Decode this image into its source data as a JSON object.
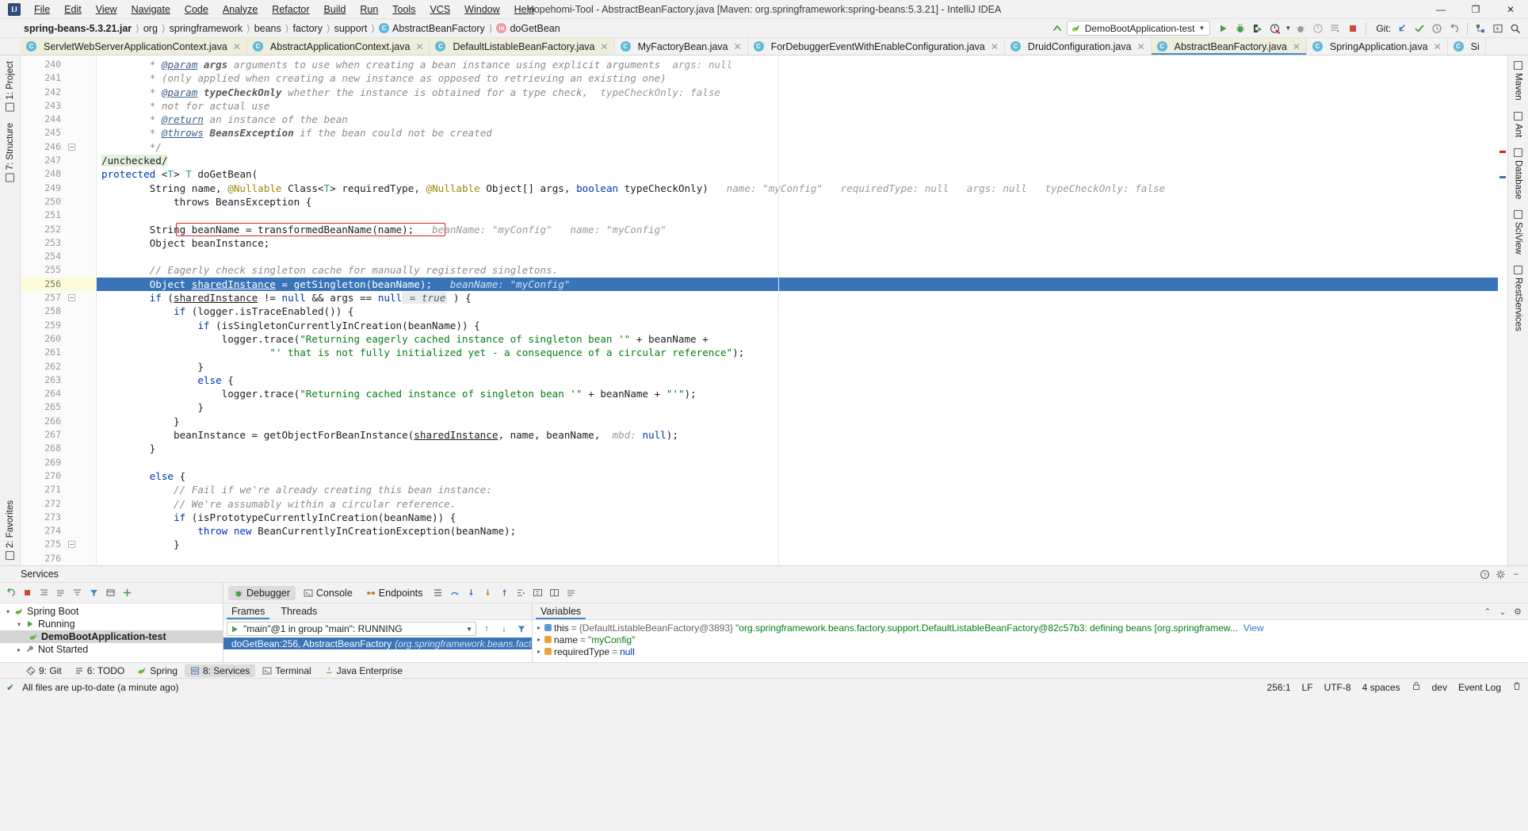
{
  "window": {
    "title": "Hopehomi-Tool - AbstractBeanFactory.java [Maven: org.springframework:spring-beans:5.3.21] - IntelliJ IDEA",
    "logo_text": "IJ",
    "minimize": "—",
    "maximize": "❐",
    "close": "✕"
  },
  "menu": [
    {
      "label": "File"
    },
    {
      "label": "Edit"
    },
    {
      "label": "View"
    },
    {
      "label": "Navigate"
    },
    {
      "label": "Code"
    },
    {
      "label": "Analyze"
    },
    {
      "label": "Refactor"
    },
    {
      "label": "Build"
    },
    {
      "label": "Run"
    },
    {
      "label": "Tools"
    },
    {
      "label": "VCS"
    },
    {
      "label": "Window"
    },
    {
      "label": "Help"
    }
  ],
  "breadcrumbs": [
    {
      "label": "spring-beans-5.3.21.jar",
      "icon": "",
      "bold": true
    },
    {
      "label": "org",
      "icon": ""
    },
    {
      "label": "springframework",
      "icon": ""
    },
    {
      "label": "beans",
      "icon": ""
    },
    {
      "label": "factory",
      "icon": ""
    },
    {
      "label": "support",
      "icon": ""
    },
    {
      "label": "AbstractBeanFactory",
      "icon": "class-icon",
      "badge": "C"
    },
    {
      "label": "doGetBean",
      "icon": "method-icon",
      "badge": "m"
    }
  ],
  "toolbar": {
    "run_config": "DemoBootApplication-test",
    "git_label": "Git:",
    "icons": [
      {
        "name": "build-icon",
        "glyph": "⬆"
      },
      {
        "name": "run-icon",
        "glyph": "▶"
      },
      {
        "name": "debug-icon",
        "glyph": "🐞"
      },
      {
        "name": "run-with-coverage-icon",
        "glyph": "▷"
      },
      {
        "name": "profile-icon",
        "glyph": "◔"
      },
      {
        "name": "attach-icon",
        "glyph": "◉"
      },
      {
        "name": "stop-icon",
        "glyph": "■"
      }
    ]
  },
  "editor_tabs": [
    {
      "label": "ServletWebServerApplicationContext.java",
      "active": false
    },
    {
      "label": "AbstractApplicationContext.java",
      "active": false
    },
    {
      "label": "DefaultListableBeanFactory.java",
      "active": false
    },
    {
      "label": "MyFactoryBean.java",
      "active": false
    },
    {
      "label": "ForDebuggerEventWithEnableConfiguration.java",
      "active": false
    },
    {
      "label": "DruidConfiguration.java",
      "active": false
    },
    {
      "label": "AbstractBeanFactory.java",
      "active": true
    },
    {
      "label": "SpringApplication.java",
      "active": false
    },
    {
      "label": "Si",
      "active": false
    }
  ],
  "left_tool_tabs": [
    {
      "label": "1: Project"
    },
    {
      "label": "7: Structure"
    },
    {
      "label": "2: Favorites"
    }
  ],
  "right_tool_tabs": [
    {
      "label": "Maven"
    },
    {
      "label": "Ant"
    },
    {
      "label": "Database"
    },
    {
      "label": "SciView"
    },
    {
      "label": "RestServices"
    }
  ],
  "editor": {
    "first_line": 239,
    "current_line": 256,
    "lines": [
      {
        "n": 240,
        "tokens": [
          {
            "t": "        * ",
            "c": "cm"
          },
          {
            "t": "@param",
            "c": "doctag"
          },
          {
            "t": " ",
            "c": "cm"
          },
          {
            "t": "args",
            "c": "cmb"
          },
          {
            "t": " arguments to use when creating a bean instance using explicit arguments",
            "c": "cm"
          },
          {
            "t": "  args: null",
            "c": "hint"
          }
        ]
      },
      {
        "n": 241,
        "tokens": [
          {
            "t": "        * (only applied when creating a new instance as opposed to retrieving an existing one)",
            "c": "cm"
          }
        ]
      },
      {
        "n": 242,
        "tokens": [
          {
            "t": "        * ",
            "c": "cm"
          },
          {
            "t": "@param",
            "c": "doctag"
          },
          {
            "t": " ",
            "c": "cm"
          },
          {
            "t": "typeCheckOnly",
            "c": "cmb"
          },
          {
            "t": " whether the instance is obtained for a type check,",
            "c": "cm"
          },
          {
            "t": "  typeCheckOnly: false",
            "c": "hint"
          }
        ]
      },
      {
        "n": 243,
        "tokens": [
          {
            "t": "        * not for actual use",
            "c": "cm"
          }
        ]
      },
      {
        "n": 244,
        "tokens": [
          {
            "t": "        * ",
            "c": "cm"
          },
          {
            "t": "@return",
            "c": "doctag"
          },
          {
            "t": " an instance of the bean",
            "c": "cm"
          }
        ]
      },
      {
        "n": 245,
        "tokens": [
          {
            "t": "        * ",
            "c": "cm"
          },
          {
            "t": "@throws",
            "c": "doctag"
          },
          {
            "t": " ",
            "c": "cm"
          },
          {
            "t": "BeansException",
            "c": "cmb"
          },
          {
            "t": " if the bean could not be created",
            "c": "cm"
          }
        ]
      },
      {
        "n": 246,
        "tokens": [
          {
            "t": "        */",
            "c": "cm"
          }
        ],
        "fold": true
      },
      {
        "n": 247,
        "tokens": [
          {
            "t": "/unchecked/",
            "c": "unchecked"
          }
        ]
      },
      {
        "n": 248,
        "tokens": [
          {
            "t": "protected",
            "c": "kw"
          },
          {
            "t": " <",
            "c": "pl"
          },
          {
            "t": "T",
            "c": "ty"
          },
          {
            "t": "> ",
            "c": "pl"
          },
          {
            "t": "T",
            "c": "ty"
          },
          {
            "t": " doGetBean(",
            "c": "pl"
          }
        ]
      },
      {
        "n": 249,
        "tokens": [
          {
            "t": "        String name, ",
            "c": "pl"
          },
          {
            "t": "@Nullable",
            "c": "anno"
          },
          {
            "t": " Class<",
            "c": "pl"
          },
          {
            "t": "T",
            "c": "ty"
          },
          {
            "t": "> requiredType, ",
            "c": "pl"
          },
          {
            "t": "@Nullable",
            "c": "anno"
          },
          {
            "t": " Object[] args, ",
            "c": "pl"
          },
          {
            "t": "boolean",
            "c": "kw"
          },
          {
            "t": " typeCheckOnly)",
            "c": "pl"
          },
          {
            "t": "   name: \"myConfig\"   requiredType: null   args: null   typeCheckOnly: false",
            "c": "hint"
          }
        ]
      },
      {
        "n": 250,
        "tokens": [
          {
            "t": "            throws BeansException {",
            "c": "pl"
          }
        ]
      },
      {
        "n": 251,
        "tokens": [
          {
            "t": "",
            "c": "pl"
          }
        ]
      },
      {
        "n": 252,
        "tokens": [
          {
            "t": "        String beanName = transformedBeanName(name);",
            "c": "pl"
          },
          {
            "t": "   beanName: \"myConfig\"   name: \"myConfig\"",
            "c": "hint"
          }
        ],
        "redbox": true
      },
      {
        "n": 253,
        "tokens": [
          {
            "t": "        Object beanInstance;",
            "c": "pl"
          }
        ]
      },
      {
        "n": 254,
        "tokens": [
          {
            "t": "",
            "c": "pl"
          }
        ]
      },
      {
        "n": 255,
        "tokens": [
          {
            "t": "        // Eagerly check singleton cache for manually registered singletons.",
            "c": "cm"
          }
        ]
      },
      {
        "n": 256,
        "tokens": [
          {
            "t": "        Object ",
            "c": "pl"
          },
          {
            "t": "sharedInstance",
            "c": "fld"
          },
          {
            "t": " = getSingleton(beanName);",
            "c": "pl"
          },
          {
            "t": "   beanName: \"myConfig\"",
            "c": "hint"
          }
        ],
        "highlight": true
      },
      {
        "n": 257,
        "tokens": [
          {
            "t": "        ",
            "c": "pl"
          },
          {
            "t": "if",
            "c": "kw"
          },
          {
            "t": " (",
            "c": "pl"
          },
          {
            "t": "sharedInstance",
            "c": "fld"
          },
          {
            "t": " != ",
            "c": "pl"
          },
          {
            "t": "null",
            "c": "kw"
          },
          {
            "t": " && args == ",
            "c": "pl"
          },
          {
            "t": "null",
            "c": "kw"
          },
          {
            "t": " = true",
            "c": "hintbg"
          },
          {
            "t": " ) {",
            "c": "pl"
          }
        ],
        "fold": true
      },
      {
        "n": 258,
        "tokens": [
          {
            "t": "            ",
            "c": "pl"
          },
          {
            "t": "if",
            "c": "kw"
          },
          {
            "t": " (logger.isTraceEnabled()) {",
            "c": "pl"
          }
        ]
      },
      {
        "n": 259,
        "tokens": [
          {
            "t": "                ",
            "c": "pl"
          },
          {
            "t": "if",
            "c": "kw"
          },
          {
            "t": " (isSingletonCurrentlyInCreation(beanName)) {",
            "c": "pl"
          }
        ]
      },
      {
        "n": 260,
        "tokens": [
          {
            "t": "                    logger.trace(",
            "c": "pl"
          },
          {
            "t": "\"Returning eagerly cached instance of singleton bean '\"",
            "c": "str"
          },
          {
            "t": " + beanName +",
            "c": "pl"
          }
        ]
      },
      {
        "n": 261,
        "tokens": [
          {
            "t": "                            ",
            "c": "pl"
          },
          {
            "t": "\"' that is not fully initialized yet - a consequence of a circular reference\"",
            "c": "str"
          },
          {
            "t": ");",
            "c": "pl"
          }
        ]
      },
      {
        "n": 262,
        "tokens": [
          {
            "t": "                }",
            "c": "pl"
          }
        ]
      },
      {
        "n": 263,
        "tokens": [
          {
            "t": "                ",
            "c": "pl"
          },
          {
            "t": "else",
            "c": "kw"
          },
          {
            "t": " {",
            "c": "pl"
          }
        ]
      },
      {
        "n": 264,
        "tokens": [
          {
            "t": "                    logger.trace(",
            "c": "pl"
          },
          {
            "t": "\"Returning cached instance of singleton bean '\"",
            "c": "str"
          },
          {
            "t": " + beanName + ",
            "c": "pl"
          },
          {
            "t": "\"'\"",
            "c": "str"
          },
          {
            "t": ");",
            "c": "pl"
          }
        ]
      },
      {
        "n": 265,
        "tokens": [
          {
            "t": "                }",
            "c": "pl"
          }
        ]
      },
      {
        "n": 266,
        "tokens": [
          {
            "t": "            }",
            "c": "pl"
          }
        ]
      },
      {
        "n": 267,
        "tokens": [
          {
            "t": "            beanInstance = getObjectForBeanInstance(",
            "c": "pl"
          },
          {
            "t": "sharedInstance",
            "c": "fld"
          },
          {
            "t": ", name, beanName, ",
            "c": "pl"
          },
          {
            "t": " mbd:",
            "c": "hint"
          },
          {
            "t": " ",
            "c": "pl"
          },
          {
            "t": "null",
            "c": "kw"
          },
          {
            "t": ");",
            "c": "pl"
          }
        ]
      },
      {
        "n": 268,
        "tokens": [
          {
            "t": "        }",
            "c": "pl"
          }
        ]
      },
      {
        "n": 269,
        "tokens": [
          {
            "t": "",
            "c": "pl"
          }
        ]
      },
      {
        "n": 270,
        "tokens": [
          {
            "t": "        ",
            "c": "pl"
          },
          {
            "t": "else",
            "c": "kw"
          },
          {
            "t": " {",
            "c": "pl"
          }
        ]
      },
      {
        "n": 271,
        "tokens": [
          {
            "t": "            // Fail if we're already creating this bean instance:",
            "c": "cm"
          }
        ]
      },
      {
        "n": 272,
        "tokens": [
          {
            "t": "            // We're assumably within a circular reference.",
            "c": "cm"
          }
        ]
      },
      {
        "n": 273,
        "tokens": [
          {
            "t": "            ",
            "c": "pl"
          },
          {
            "t": "if",
            "c": "kw"
          },
          {
            "t": " (isPrototypeCurrentlyInCreation(beanName)) {",
            "c": "pl"
          }
        ]
      },
      {
        "n": 274,
        "tokens": [
          {
            "t": "                ",
            "c": "pl"
          },
          {
            "t": "throw",
            "c": "kw"
          },
          {
            "t": " ",
            "c": "pl"
          },
          {
            "t": "new",
            "c": "kw"
          },
          {
            "t": " BeanCurrentlyInCreationException(beanName);",
            "c": "pl"
          }
        ]
      },
      {
        "n": 275,
        "tokens": [
          {
            "t": "            }",
            "c": "pl"
          }
        ],
        "fold": true
      },
      {
        "n": 276,
        "tokens": [
          {
            "t": "",
            "c": "pl"
          }
        ]
      }
    ]
  },
  "services": {
    "header_title": "Services",
    "tree": [
      {
        "label": "Spring Boot",
        "depth": 0,
        "expanded": true,
        "icon": "leaf-icon",
        "selected": false
      },
      {
        "label": "Running",
        "depth": 1,
        "expanded": true,
        "icon": "run-icon",
        "selected": false
      },
      {
        "label": "DemoBootApplication-test",
        "depth": 2,
        "expanded": false,
        "icon": "leaf-icon",
        "selected": true,
        "bold": true
      },
      {
        "label": "Not Started",
        "depth": 1,
        "expanded": false,
        "icon": "wrench-icon",
        "selected": false
      }
    ],
    "debug_tabs": [
      {
        "label": "Debugger",
        "active": true,
        "icon": "debugger-icon"
      },
      {
        "label": "Console",
        "active": false,
        "icon": "console-icon"
      },
      {
        "label": "Endpoints",
        "active": false,
        "icon": "endpoints-icon"
      }
    ],
    "frames_panel": {
      "tabs": [
        {
          "label": "Frames",
          "active": true
        },
        {
          "label": "Threads",
          "active": false
        }
      ],
      "thread_selector": "\"main\"@1 in group \"main\": RUNNING",
      "frames": [
        {
          "method": "doGetBean:256, AbstractBeanFactory",
          "location": "(org.springframework.beans.factory.supp",
          "selected": true
        }
      ]
    },
    "variables_panel": {
      "title": "Variables",
      "rows": [
        {
          "indent": 0,
          "expandable": true,
          "name": "this",
          "eq": "=",
          "value": "{DefaultListableBeanFactory@3893}",
          "detail": "\"org.springframework.beans.factory.support.DefaultListableBeanFactory@82c57b3: defining beans [org.springframew...",
          "link": "View",
          "icon": "field-blue"
        },
        {
          "indent": 0,
          "expandable": true,
          "name": "name",
          "eq": "=",
          "value": "\"myConfig\"",
          "detail": "",
          "icon": "field-orange"
        },
        {
          "indent": 0,
          "expandable": true,
          "name": "requiredType",
          "eq": "=",
          "value": "null",
          "detail": "",
          "icon": "field-orange"
        }
      ]
    }
  },
  "bottom_tabs": [
    {
      "label": "9: Git",
      "icon": "git-icon",
      "active": false
    },
    {
      "label": "6: TODO",
      "icon": "todo-icon",
      "active": false
    },
    {
      "label": "Spring",
      "icon": "spring-icon",
      "active": false
    },
    {
      "label": "8: Services",
      "icon": "services-icon",
      "active": true
    },
    {
      "label": "Terminal",
      "icon": "terminal-icon",
      "active": false
    },
    {
      "label": "Java Enterprise",
      "icon": "java-icon",
      "active": false
    }
  ],
  "status_bar": {
    "message": "All files are up-to-date (a minute ago)",
    "caret": "256:1",
    "line_sep": "LF",
    "encoding": "UTF-8",
    "indent": "4 spaces",
    "event_log": "Event Log",
    "branch": "dev"
  },
  "colors": {
    "accent_blue": "#3a74b8",
    "tab_active_bg": "#eeeedc",
    "breakpoint_red": "#e02020",
    "keyword_blue": "#0033b3",
    "string_green": "#067d17",
    "comment_gray": "#8c8c8c"
  }
}
